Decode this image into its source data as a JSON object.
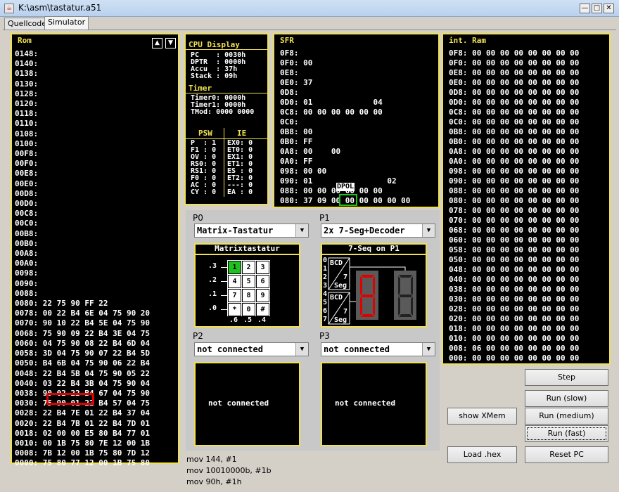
{
  "window": {
    "title": "K:\\asm\\tastatur.a51"
  },
  "tabs": [
    "Quellcode",
    "Simulator"
  ],
  "rom": {
    "title": "Rom",
    "rows": [
      "0148:",
      "0140:",
      "0138:",
      "0130:",
      "0128:",
      "0120:",
      "0118:",
      "0110:",
      "0108:",
      "0100:",
      "00F8:",
      "00F0:",
      "00E8:",
      "00E0:",
      "00D8:",
      "00D0:",
      "00C8:",
      "00C0:",
      "00B8:",
      "00B0:",
      "00A8:",
      "00A0:",
      "0098:",
      "0090:",
      "0088:",
      "0080: 22 75 90 FF 22",
      "0078: 00 22 B4 6E 04 75 90 20",
      "0070: 90 10 22 B4 5E 04 75 90",
      "0068: 75 90 09 22 B4 3E 04 75",
      "0060: 04 75 90 08 22 B4 6D 04",
      "0058: 3D 04 75 90 07 22 B4 5D",
      "0050: B4 6B 04 75 90 06 22 B4",
      "0048: 22 B4 5B 04 75 90 05 22",
      "0040: 03 22 B4 3B 04 75 90 04",
      "0038: 90 02 22 B4 67 04 75 90",
      "0030: 75 90 01 22 B4 57 04 75",
      "0028: 22 B4 7E 01 22 B4 37 04",
      "0020: 22 B4 7B 01 22 B4 7D 01",
      "0018: 02 00 00 E5 80 B4 77 01",
      "0010: 00 1B 75 80 7E 12 00 1B",
      "0008: 7B 12 00 1B 75 80 7D 12",
      "0000: 75 80 77 12 00 1B 75 80"
    ]
  },
  "cpu": {
    "title": "CPU Display",
    "rows": [
      "PC    : 0030h",
      "DPTR  : 0000h",
      "Accu  : 37h",
      "Stack : 09h"
    ],
    "timer_title": "Timer",
    "timer_rows": [
      "Timer0: 0000h",
      "Timer1: 0000h",
      "TMod: 0000 0000"
    ],
    "psw_title": "PSW",
    "ie_title": "IE",
    "psw_rows": [
      "P  : 1",
      "F1 : 0",
      "OV : 0",
      "RS0: 0",
      "RS1: 0",
      "F0 : 0",
      "AC : 0",
      "CY : 0"
    ],
    "ie_rows": [
      "EX0: 0",
      "ET0: 0",
      "EX1: 0",
      "ET1: 0",
      "ES : 0",
      "ET2: 0",
      "---: 0",
      "EA : 0"
    ]
  },
  "sfr": {
    "title": "SFR",
    "rows": [
      "0F8:",
      "0F0: 00",
      "0E8:",
      "0E0: 37",
      "0D8:",
      "0D0: 01             04",
      "0C8: 00 00 00 00 00 00",
      "0C0:",
      "0B8: 00",
      "0B0: FF",
      "0A8: 00    00",
      "0A0: FF",
      "098: 00 00",
      "090: 01                02",
      "088: 00 00 00 00 00 00",
      "080: 37 09 00 00 00 00 00 00"
    ],
    "tooltip": "DPOL"
  },
  "iram": {
    "title": "int. Ram",
    "rows": [
      "0F8: 00 00 00 00 00 00 00 00",
      "0F0: 00 00 00 00 00 00 00 00",
      "0E8: 00 00 00 00 00 00 00 00",
      "0E0: 00 00 00 00 00 00 00 00",
      "0D8: 00 00 00 00 00 00 00 00",
      "0D0: 00 00 00 00 00 00 00 00",
      "0C8: 00 00 00 00 00 00 00 00",
      "0C0: 00 00 00 00 00 00 00 00",
      "0B8: 00 00 00 00 00 00 00 00",
      "0B0: 00 00 00 00 00 00 00 00",
      "0A8: 00 00 00 00 00 00 00 00",
      "0A0: 00 00 00 00 00 00 00 00",
      "098: 00 00 00 00 00 00 00 00",
      "090: 00 00 00 00 00 00 00 00",
      "088: 00 00 00 00 00 00 00 00",
      "080: 00 00 00 00 00 00 00 00",
      "078: 00 00 00 00 00 00 00 00",
      "070: 00 00 00 00 00 00 00 00",
      "068: 00 00 00 00 00 00 00 00",
      "060: 00 00 00 00 00 00 00 00",
      "058: 00 00 00 00 00 00 00 00",
      "050: 00 00 00 00 00 00 00 00",
      "048: 00 00 00 00 00 00 00 00",
      "040: 00 00 00 00 00 00 00 00",
      "038: 00 00 00 00 00 00 00 00",
      "030: 00 00 00 00 00 00 00 00",
      "028: 00 00 00 00 00 00 00 00",
      "020: 00 00 00 00 00 00 00 00",
      "018: 00 00 00 00 00 00 00 00",
      "010: 00 00 00 00 00 00 00 00",
      "008: 06 00 00 00 00 00 00 00",
      "000: 00 00 00 00 00 00 00 00"
    ]
  },
  "ports": {
    "p0": {
      "label": "P0",
      "value": "Matrix-Tastatur"
    },
    "p1": {
      "label": "P1",
      "value": "2x 7-Seg+Decoder"
    },
    "p2": {
      "label": "P2",
      "value": "not connected"
    },
    "p3": {
      "label": "P3",
      "value": "not connected"
    }
  },
  "keypad": {
    "title": "Matrixtastatur",
    "row_labels": [
      ".3",
      ".2",
      ".1",
      ".0"
    ],
    "keys": [
      [
        "1",
        "2",
        "3"
      ],
      [
        "4",
        "5",
        "6"
      ],
      [
        "7",
        "8",
        "9"
      ],
      [
        "*",
        "0",
        "#"
      ]
    ],
    "col_labels": [
      ".6",
      ".5",
      ".4"
    ],
    "pressed": "1"
  },
  "sevenseg": {
    "title": "7-Seq on P1",
    "bits": [
      "0",
      "1",
      "2",
      "3",
      "4",
      "5",
      "6",
      "7"
    ],
    "bcd_label": "BCD",
    "seg_label": "Seg",
    "seven": "7",
    "digit_color": "#e00000",
    "off_color": "#555555"
  },
  "p2_device": {
    "text": "not connected"
  },
  "p3_device": {
    "text": "not connected"
  },
  "buttons": {
    "step": "Step",
    "run_slow": "Run (slow)",
    "run_medium": "Run (medium)",
    "run_fast": "Run (fast)",
    "show_xmem": "show XMem",
    "load_hex": "Load .hex",
    "reset_pc": "Reset PC"
  },
  "log": [
    "mov 144, #1",
    "mov 10010000b, #1b",
    "mov 90h, #1h"
  ]
}
